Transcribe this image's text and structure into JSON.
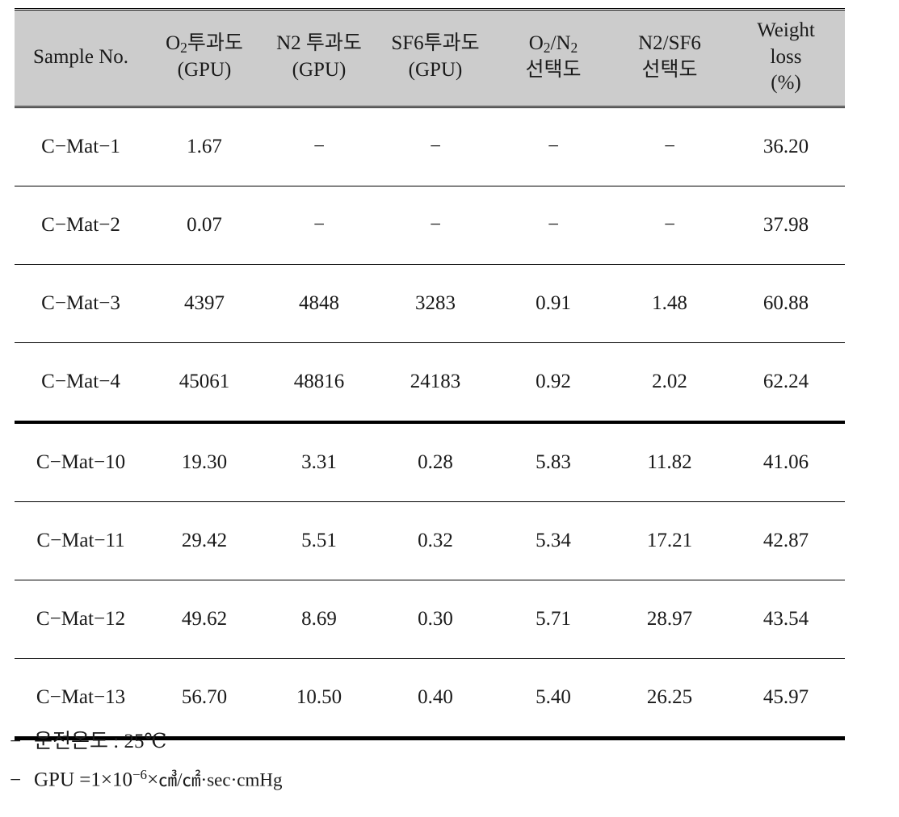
{
  "table": {
    "columns": [
      {
        "id": "sample_no",
        "lines": [
          "Sample No."
        ]
      },
      {
        "id": "o2_permeance",
        "lines": [
          "O₂투과도",
          "(GPU)"
        ]
      },
      {
        "id": "n2_permeance",
        "lines": [
          "N2 투과도",
          "(GPU)"
        ]
      },
      {
        "id": "sf6_permeance",
        "lines": [
          "SF6투과도",
          "(GPU)"
        ]
      },
      {
        "id": "o2_n2_selectivity",
        "lines": [
          "O₂/N₂",
          "선택도"
        ]
      },
      {
        "id": "n2_sf6_selectivity",
        "lines": [
          "N2/SF6",
          "선택도"
        ]
      },
      {
        "id": "weight_loss",
        "lines": [
          "Weight",
          "loss",
          "(%)"
        ]
      }
    ],
    "rows": [
      {
        "sample_no": "C−Mat−1",
        "o2_permeance": "1.67",
        "n2_permeance": "−",
        "sf6_permeance": "−",
        "o2_n2_selectivity": "−",
        "n2_sf6_selectivity": "−",
        "weight_loss": "36.20"
      },
      {
        "sample_no": "C−Mat−2",
        "o2_permeance": "0.07",
        "n2_permeance": "−",
        "sf6_permeance": "−",
        "o2_n2_selectivity": "−",
        "n2_sf6_selectivity": "−",
        "weight_loss": "37.98"
      },
      {
        "sample_no": "C−Mat−3",
        "o2_permeance": "4397",
        "n2_permeance": "4848",
        "sf6_permeance": "3283",
        "o2_n2_selectivity": "0.91",
        "n2_sf6_selectivity": "1.48",
        "weight_loss": "60.88"
      },
      {
        "sample_no": "C−Mat−4",
        "o2_permeance": "45061",
        "n2_permeance": "48816",
        "sf6_permeance": "24183",
        "o2_n2_selectivity": "0.92",
        "n2_sf6_selectivity": "2.02",
        "weight_loss": "62.24"
      },
      {
        "sample_no": "C−Mat−10",
        "o2_permeance": "19.30",
        "n2_permeance": "3.31",
        "sf6_permeance": "0.28",
        "o2_n2_selectivity": "5.83",
        "n2_sf6_selectivity": "11.82",
        "weight_loss": "41.06"
      },
      {
        "sample_no": "C−Mat−11",
        "o2_permeance": "29.42",
        "n2_permeance": "5.51",
        "sf6_permeance": "0.32",
        "o2_n2_selectivity": "5.34",
        "n2_sf6_selectivity": "17.21",
        "weight_loss": "42.87"
      },
      {
        "sample_no": "C−Mat−12",
        "o2_permeance": "49.62",
        "n2_permeance": "8.69",
        "sf6_permeance": "0.30",
        "o2_n2_selectivity": "5.71",
        "n2_sf6_selectivity": "28.97",
        "weight_loss": "43.54"
      },
      {
        "sample_no": "C−Mat−13",
        "o2_permeance": "56.70",
        "n2_permeance": "10.50",
        "sf6_permeance": "0.40",
        "o2_n2_selectivity": "5.40",
        "n2_sf6_selectivity": "26.25",
        "weight_loss": "45.97"
      }
    ]
  },
  "footnotes": [
    {
      "dash": "−",
      "text": "운전온도 : 25℃"
    },
    {
      "dash": "−",
      "label": "GPU",
      "equals": "=1×10",
      "exponent": "−6",
      "times": "×",
      "units": "㎤/㎠·sec·cmHg"
    }
  ],
  "style": {
    "header_bg": "#cccccc",
    "text_color": "#1a1a1a",
    "rule_color": "#000000"
  }
}
